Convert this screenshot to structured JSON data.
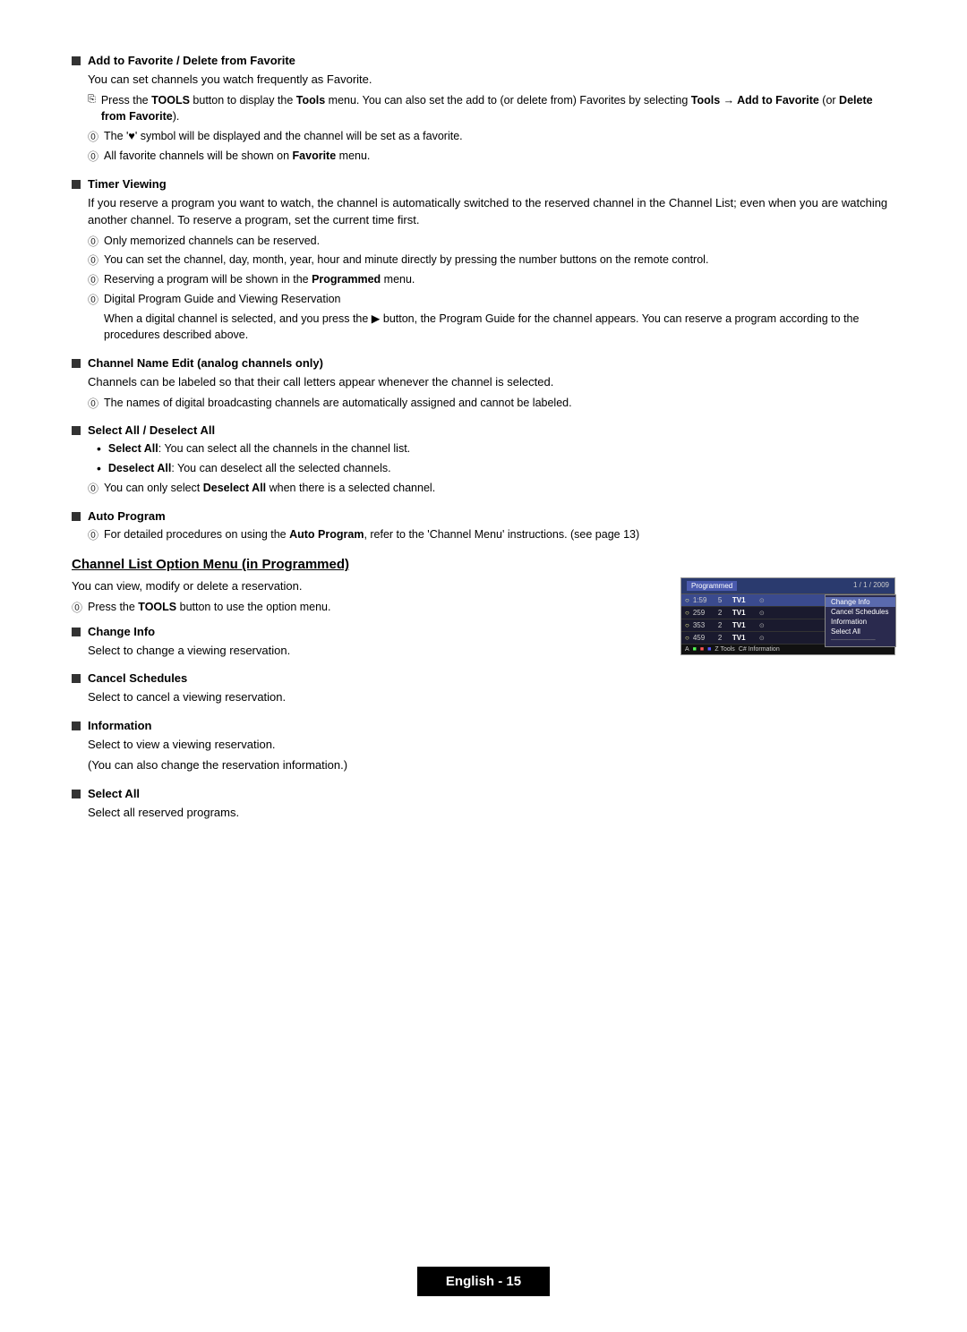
{
  "page": {
    "title": "Channel List Option Menu (in Programmed)",
    "footer_label": "English - 15"
  },
  "sections": {
    "add_to_favorite": {
      "title": "Add to Favorite / Delete from Favorite",
      "body": "You can set channels you watch frequently as Favorite.",
      "notes": [
        {
          "type": "tools",
          "text_parts": [
            "Press the ",
            "TOOLS",
            " button to display the ",
            "Tools",
            " menu. You can also set the add to (or delete from) Favorites by selecting ",
            "Tools",
            " → ",
            "Add to Favorite",
            " (or ",
            "Delete from Favorite",
            ")."
          ]
        },
        {
          "type": "note",
          "text": "The '♥' symbol will be displayed and the channel will be set as a favorite."
        },
        {
          "type": "note",
          "text": "All favorite channels will be shown on Favorite menu.",
          "bold_words": [
            "Favorite"
          ]
        }
      ]
    },
    "timer_viewing": {
      "title": "Timer Viewing",
      "body": "If you reserve a program you want to watch, the channel is automatically switched to the reserved channel in the Channel List; even when you are watching another channel. To reserve a program, set the current time first.",
      "notes": [
        {
          "type": "note",
          "text": "Only memorized channels can be reserved."
        },
        {
          "type": "note",
          "text": "You can set the channel, day, month, year, hour and minute directly by pressing the number buttons on the remote control."
        },
        {
          "type": "note",
          "text": "Reserving a program will be shown in the Programmed menu.",
          "bold_words": [
            "Programmed"
          ]
        },
        {
          "type": "subheader",
          "text": "Digital Program Guide and Viewing Reservation",
          "body": "When a digital channel is selected, and you press the ▶ button, the Program Guide for the channel appears. You can reserve a program according to the procedures described above."
        }
      ]
    },
    "channel_name_edit": {
      "title": "Channel Name Edit (analog channels only)",
      "body": "Channels can be labeled so that their call letters appear whenever the channel is selected.",
      "notes": [
        {
          "type": "note",
          "text": "The names of digital broadcasting channels are automatically assigned and cannot be labeled."
        }
      ]
    },
    "select_all": {
      "title": "Select All / Deselect All",
      "bullets": [
        {
          "label": "Select All",
          "text": ": You can select all the channels in the channel list."
        },
        {
          "label": "Deselect All",
          "text": ": You can deselect all the selected channels."
        }
      ],
      "note": "You can only select Deselect All when there is a selected channel.",
      "note_bold": "Deselect All"
    },
    "auto_program": {
      "title": "Auto Program",
      "note": "For detailed procedures on using the Auto Program, refer to the 'Channel Menu' instructions. (see page 13)",
      "note_bold": "Auto Program"
    }
  },
  "programmed_section": {
    "heading": "Channel List Option Menu (in Programmed)",
    "intro": "You can view, modify or delete a reservation.",
    "tools_note": "Press the TOOLS button to use the option menu.",
    "items": [
      {
        "title": "Change Info",
        "body": "Select to change a viewing reservation."
      },
      {
        "title": "Cancel Schedules",
        "body": "Select to cancel a viewing reservation."
      },
      {
        "title": "Information",
        "body1": "Select to view a viewing reservation.",
        "body2": "(You can also change the reservation information.)"
      },
      {
        "title": "Select All",
        "body": "Select all reserved programs."
      }
    ]
  },
  "tv_screen": {
    "header_left": "Programmed",
    "header_right": "1 / 1 / 2009",
    "channels": [
      {
        "num": "1:59",
        "count": "5",
        "name": "TV1",
        "icon": "⊙"
      },
      {
        "num": "259",
        "count": "2",
        "name": "TV1",
        "icon": "⊙"
      },
      {
        "num": "353",
        "count": "2",
        "name": "TV1",
        "icon": "⊙"
      },
      {
        "num": "459",
        "count": "2",
        "name": "TV1",
        "icon": "⊙"
      }
    ],
    "context_menu": [
      {
        "label": "Change Info",
        "active": true
      },
      {
        "label": "Cancel Schedules",
        "active": false
      },
      {
        "label": "Information",
        "active": false
      },
      {
        "label": "Select All",
        "active": false
      },
      {
        "label": "--------",
        "active": false
      }
    ],
    "footer_items": [
      "A",
      "B■",
      "C■",
      "D■",
      "Z Tools",
      "C# Information"
    ]
  }
}
